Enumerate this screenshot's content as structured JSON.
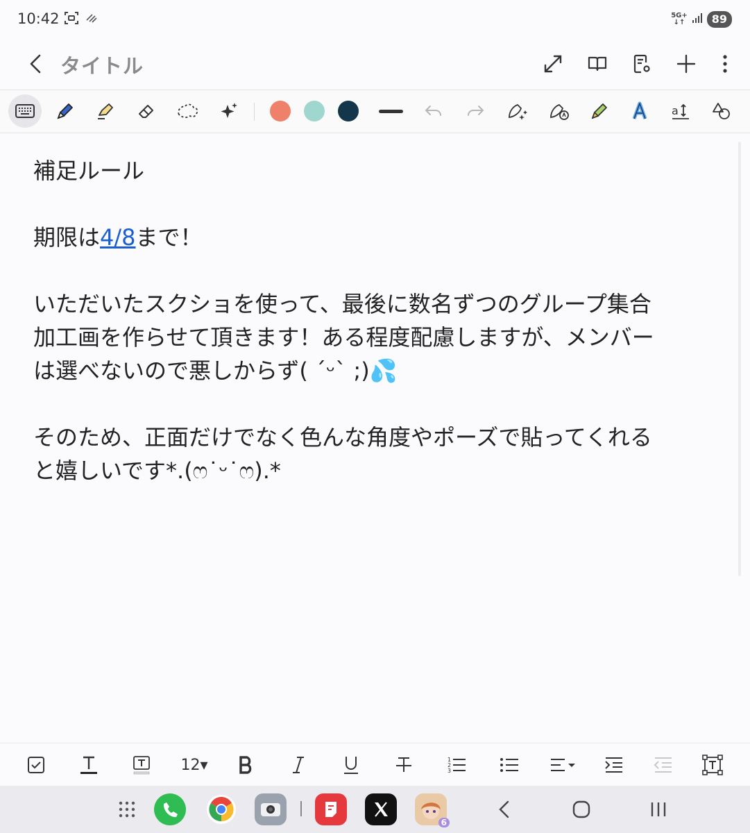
{
  "status_bar": {
    "time": "10:42",
    "network": "5G+",
    "battery": "89"
  },
  "header": {
    "title": "タイトル"
  },
  "toolbar": {
    "colors": [
      "#ef8069",
      "#9fd6cd",
      "#14364b"
    ]
  },
  "note": {
    "heading": "補足ルール",
    "deadline_prefix": "期限は",
    "deadline_date": "4/8",
    "deadline_suffix": "まで！",
    "para1_line1": "いただいたスクショを使って、最後に数名ずつのグループ集合",
    "para1_line2": "加工画を作らせて頂きます！ある程度配慮しますが、メンバー",
    "para1_line3": "は選べないので悪しからず( ´ᵕ` ;)💦",
    "para2_line1": "そのため、正面だけでなく色んな角度やポーズで貼ってくれる",
    "para2_line2": "と嬉しいです*.(ෆ˙ᵕ˙ෆ).*"
  },
  "format_bar": {
    "font_size": "12▾"
  },
  "dock": {
    "game_badge": "6"
  }
}
